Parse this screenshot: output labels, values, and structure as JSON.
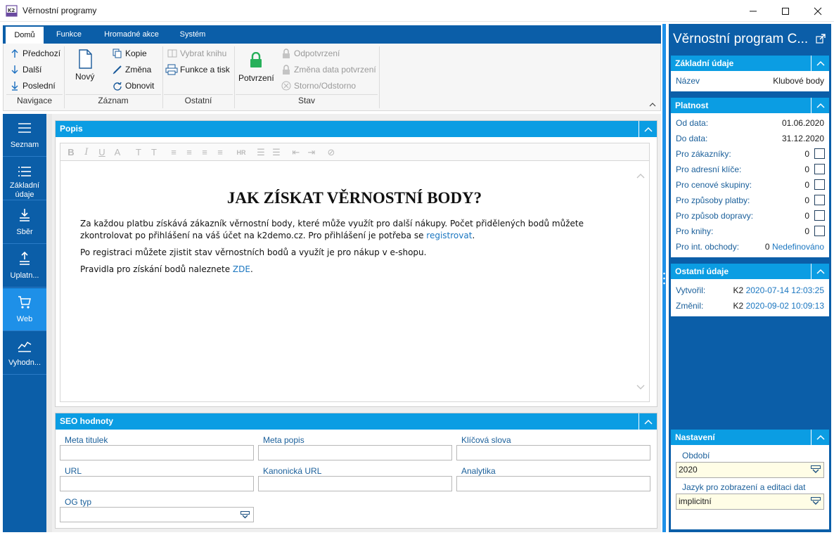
{
  "window": {
    "title": "Věrnostní programy",
    "app_icon": "k2-app-icon"
  },
  "ribbon": {
    "tabs": [
      {
        "label": "Domů",
        "active": true
      },
      {
        "label": "Funkce"
      },
      {
        "label": "Hromadné akce"
      },
      {
        "label": "Systém"
      }
    ],
    "navigace": {
      "label": "Navigace",
      "prev": "Předchozí",
      "next": "Další",
      "last": "Poslední"
    },
    "zaznam": {
      "label": "Záznam",
      "new": "Nový",
      "copy": "Kopie",
      "change": "Změna",
      "refresh": "Obnovit"
    },
    "ostatni": {
      "label": "Ostatní",
      "choose_book": "Vybrat knihu",
      "func_print": "Funkce a tisk"
    },
    "stav": {
      "label": "Stav",
      "confirm": "Potvrzení",
      "unconfirm": "Odpotvrzení",
      "change_date": "Změna data potvrzení",
      "storno": "Storno/Odstorno"
    }
  },
  "leftnav": [
    {
      "label": "Seznam",
      "icon": "list-icon"
    },
    {
      "label": "Základní údaje",
      "icon": "details-icon"
    },
    {
      "label": "Sběr",
      "icon": "collect-icon"
    },
    {
      "label": "Uplatn...",
      "icon": "apply-icon"
    },
    {
      "label": "Web",
      "icon": "cart-icon",
      "active": true
    },
    {
      "label": "Vyhodn...",
      "icon": "chart-icon"
    }
  ],
  "popis": {
    "header": "Popis",
    "doc": {
      "heading": "JAK ZÍSKAT VĚRNOSTNÍ BODY?",
      "p1_text": "Za každou platbu získává zákazník věrnostní body, které může využít pro další nákupy. Počet přidělených bodů můžete zkontrolovat po přihlášení na váš účet na k2demo.cz. Pro přihlášení je potřeba se ",
      "p1_link": "registrovat",
      "p1_end": ".",
      "p2": "Po registraci můžete zjistit stav věrnostních bodů a využít je pro nákup v e-shopu.",
      "p3_text": "Pravidla pro získání bodů naleznete ",
      "p3_link": "ZDE",
      "p3_end": "."
    }
  },
  "seo": {
    "header": "SEO hodnoty",
    "meta_title": "Meta titulek",
    "meta_desc": "Meta popis",
    "keywords": "Klíčová slova",
    "url": "URL",
    "canonical": "Kanonická URL",
    "analytics": "Analytika",
    "og_type": "OG typ"
  },
  "right": {
    "title": "Věrnostní program C...",
    "basic": {
      "header": "Základní údaje",
      "name_label": "Název",
      "name_value": "Klubové body"
    },
    "validity": {
      "header": "Platnost",
      "from_label": "Od data:",
      "from_value": "01.06.2020",
      "to_label": "Do data:",
      "to_value": "31.12.2020",
      "rows": [
        {
          "label": "Pro zákazníky:",
          "count": "0"
        },
        {
          "label": "Pro adresní klíče:",
          "count": "0"
        },
        {
          "label": "Pro cenové skupiny:",
          "count": "0"
        },
        {
          "label": "Pro způsoby platby:",
          "count": "0"
        },
        {
          "label": "Pro způsob dopravy:",
          "count": "0"
        },
        {
          "label": "Pro knihy:",
          "count": "0"
        }
      ],
      "int_label": "Pro int. obchody:",
      "int_count": "0",
      "int_value": "Nedefinováno"
    },
    "other": {
      "header": "Ostatní údaje",
      "created_label": "Vytvořil:",
      "created_user": "K2",
      "created_date": "2020-07-14 12:03:25",
      "changed_label": "Změnil:",
      "changed_user": "K2",
      "changed_date": "2020-09-02 10:09:13"
    },
    "settings": {
      "header": "Nastavení",
      "period_label": "Období",
      "period_value": "2020",
      "lang_label": "Jazyk pro zobrazení a editaci dat",
      "lang_value": "implicitní"
    }
  }
}
